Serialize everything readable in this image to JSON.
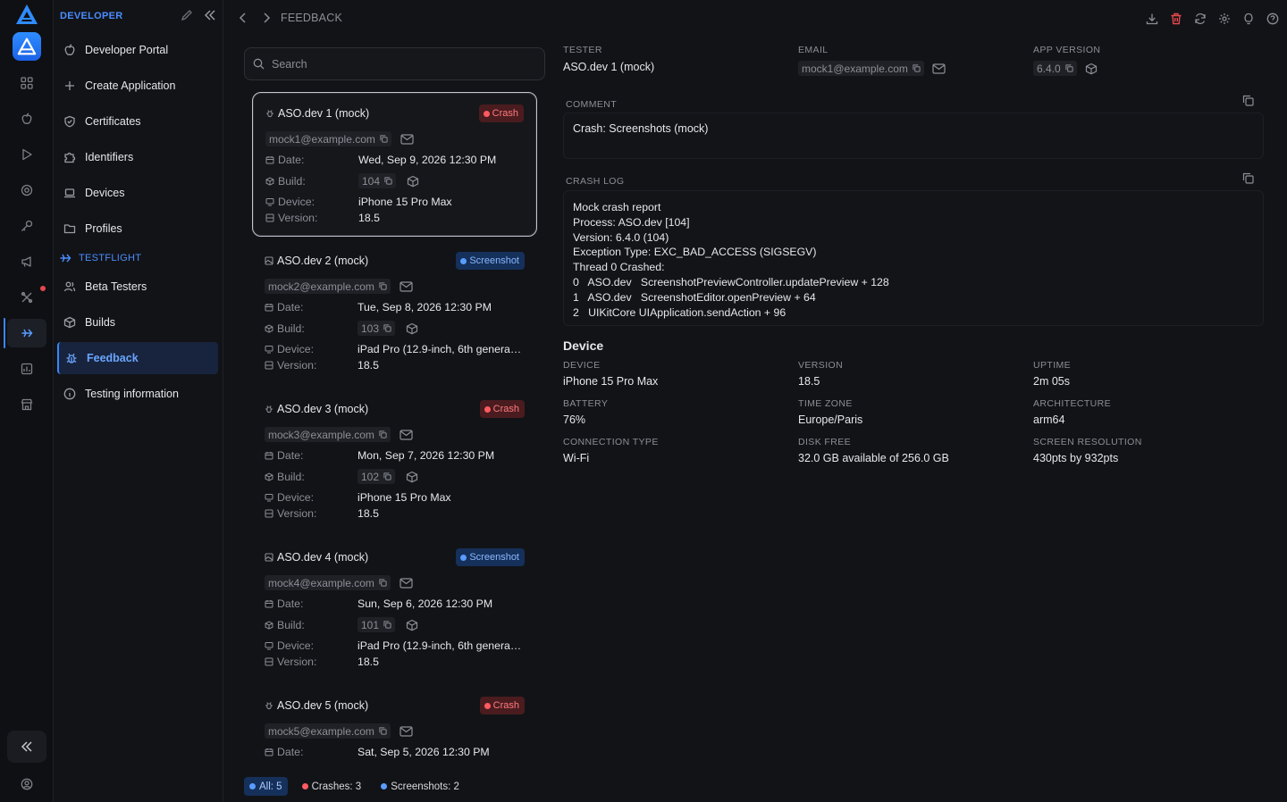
{
  "brand": {
    "accent": "#3a86ff",
    "crash": "#e5484d",
    "screenshot": "#5a9cff"
  },
  "rail": {
    "icons": [
      "logo-icon",
      "app-icon",
      "apps-icon",
      "apple-icon",
      "play-icon",
      "target-icon",
      "key-icon",
      "megaphone-icon",
      "tools-icon",
      "testflight-icon",
      "chart-icon",
      "store-icon"
    ],
    "collapse_icon": "double-chevron-left-icon",
    "profile_icon": "profile-icon"
  },
  "sidenav": {
    "header": "DEVELOPER",
    "items": [
      {
        "label": "Developer Portal",
        "icon": "portal-icon"
      },
      {
        "label": "Create Application",
        "icon": "plus-icon"
      },
      {
        "label": "Certificates",
        "icon": "shield-icon"
      },
      {
        "label": "Identifiers",
        "icon": "puzzle-icon"
      },
      {
        "label": "Devices",
        "icon": "laptop-icon"
      },
      {
        "label": "Profiles",
        "icon": "folder-icon"
      }
    ],
    "section": "TESTFLIGHT",
    "tf_items": [
      {
        "label": "Beta Testers",
        "icon": "users-icon"
      },
      {
        "label": "Builds",
        "icon": "box-icon"
      },
      {
        "label": "Feedback",
        "icon": "bug-icon"
      },
      {
        "label": "Testing information",
        "icon": "info-icon"
      }
    ]
  },
  "breadcrumb": {
    "label": "FEEDBACK"
  },
  "toolbar": [
    "download-icon",
    "trash-icon",
    "refresh-icon",
    "settings-icon",
    "lightbulb-icon",
    "help-icon"
  ],
  "search": {
    "placeholder": "Search",
    "value": ""
  },
  "labels": {
    "date": "Date:",
    "build": "Build:",
    "device": "Device:",
    "version": "Version:"
  },
  "feedback": [
    {
      "title": "ASO.dev 1 (mock)",
      "type": "Crash",
      "email": "mock1@example.com",
      "date": "Wed, Sep 9, 2026 12:30 PM",
      "build": "104",
      "device": "iPhone 15 Pro Max",
      "version": "18.5"
    },
    {
      "title": "ASO.dev 2 (mock)",
      "type": "Screenshot",
      "email": "mock2@example.com",
      "date": "Tue, Sep 8, 2026 12:30 PM",
      "build": "103",
      "device": "iPad Pro (12.9-inch, 6th generati...",
      "version": "18.5"
    },
    {
      "title": "ASO.dev 3 (mock)",
      "type": "Crash",
      "email": "mock3@example.com",
      "date": "Mon, Sep 7, 2026 12:30 PM",
      "build": "102",
      "device": "iPhone 15 Pro Max",
      "version": "18.5"
    },
    {
      "title": "ASO.dev 4 (mock)",
      "type": "Screenshot",
      "email": "mock4@example.com",
      "date": "Sun, Sep 6, 2026 12:30 PM",
      "build": "101",
      "device": "iPad Pro (12.9-inch, 6th generati...",
      "version": "18.5"
    },
    {
      "title": "ASO.dev 5 (mock)",
      "type": "Crash",
      "email": "mock5@example.com",
      "date": "Sat, Sep 5, 2026 12:30 PM",
      "build": "",
      "device": "",
      "version": ""
    }
  ],
  "filters": {
    "all": "All: 5",
    "crashes": "Crashes: 3",
    "screenshots": "Screenshots: 2"
  },
  "detail": {
    "tester_label": "TESTER",
    "tester": "ASO.dev 1 (mock)",
    "email_label": "EMAIL",
    "email": "mock1@example.com",
    "app_version_label": "APP VERSION",
    "app_version": "6.4.0",
    "comment_label": "COMMENT",
    "comment": "Crash: Screenshots (mock)",
    "crash_log_label": "CRASH LOG",
    "crash_log": [
      "Mock crash report",
      "Process: ASO.dev [104]",
      "Version: 6.4.0 (104)",
      "Exception Type: EXC_BAD_ACCESS (SIGSEGV)",
      "Thread 0 Crashed:",
      "0   ASO.dev   ScreenshotPreviewController.updatePreview + 128",
      "1   ASO.dev   ScreenshotEditor.openPreview + 64",
      "2   UIKitCore UIApplication.sendAction + 96"
    ],
    "device_title": "Device",
    "device_info": [
      {
        "label": "DEVICE",
        "value": "iPhone 15 Pro Max"
      },
      {
        "label": "VERSION",
        "value": "18.5"
      },
      {
        "label": "UPTIME",
        "value": "2m 05s"
      },
      {
        "label": "BATTERY",
        "value": "76%"
      },
      {
        "label": "TIME ZONE",
        "value": "Europe/Paris"
      },
      {
        "label": "ARCHITECTURE",
        "value": "arm64"
      },
      {
        "label": "CONNECTION TYPE",
        "value": "Wi-Fi"
      },
      {
        "label": "DISK FREE",
        "value": "32.0 GB available of 256.0 GB"
      },
      {
        "label": "SCREEN RESOLUTION",
        "value": "430pts by 932pts"
      }
    ]
  }
}
